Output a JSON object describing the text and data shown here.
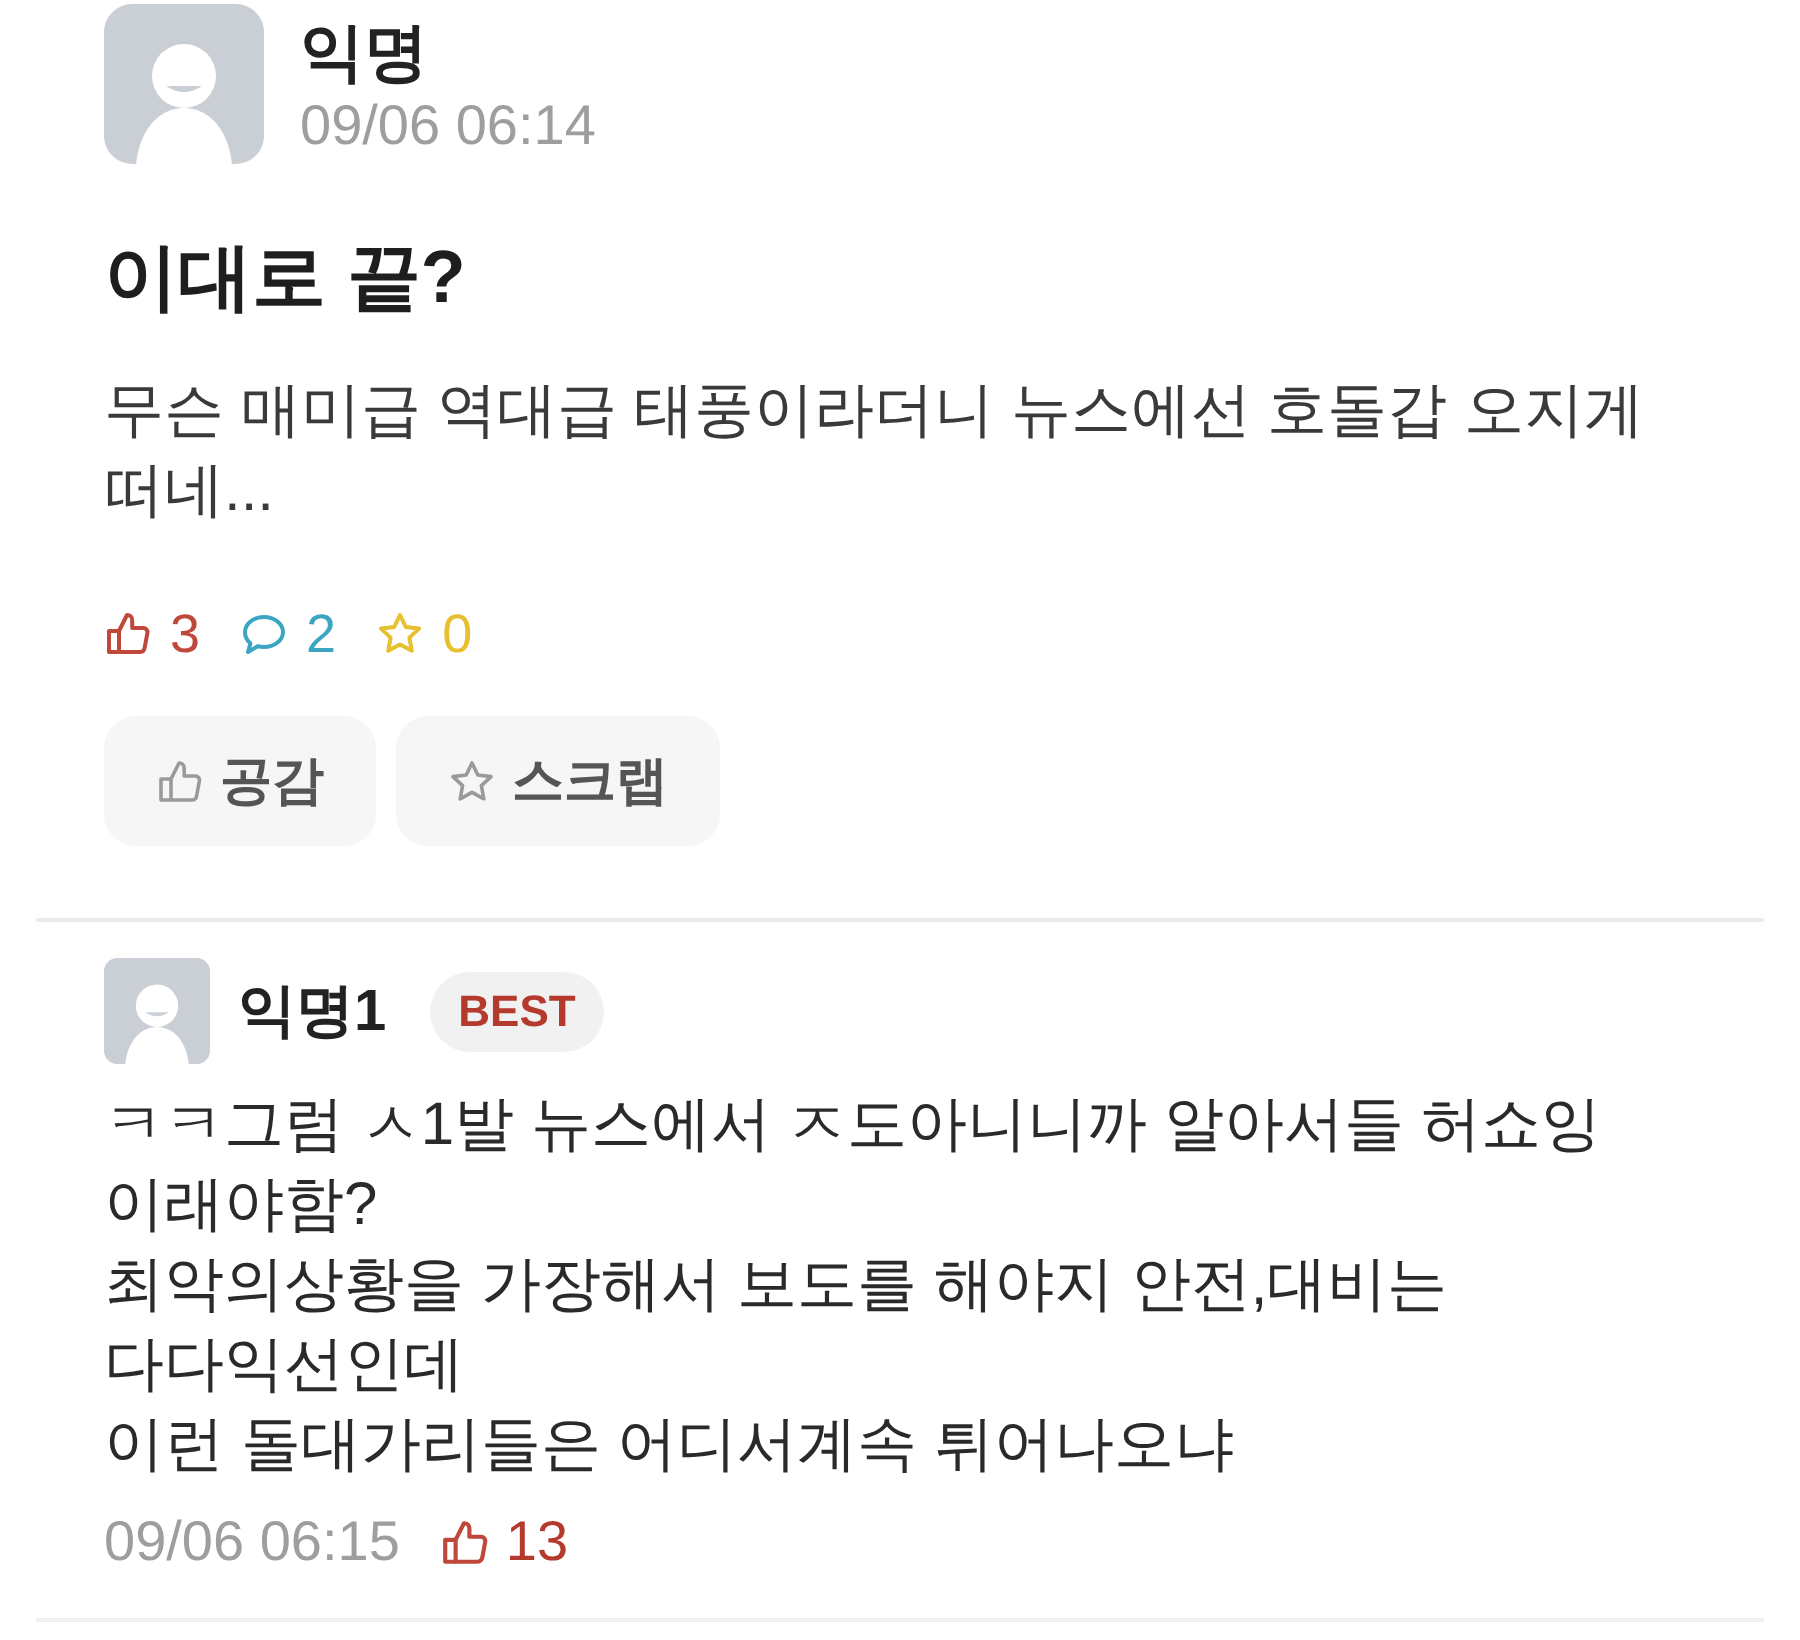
{
  "post": {
    "author": "익명",
    "time": "09/06 06:14",
    "title": "이대로 끝?",
    "body": "무슨 매미급 역대급 태풍이라더니 뉴스에선 호돌갑 오지게\n떠네...",
    "stats": [
      {
        "kind": "like",
        "count": "3",
        "color": "#c0483b"
      },
      {
        "kind": "comment",
        "count": "2",
        "color": "#3aa6c4"
      },
      {
        "kind": "scrap",
        "count": "0",
        "color": "#e6c02e"
      }
    ],
    "buttons": [
      {
        "kind": "like",
        "label": "공감"
      },
      {
        "kind": "scrap",
        "label": "스크랩"
      }
    ]
  },
  "comments": [
    {
      "author": "익명1",
      "badge": "BEST",
      "body": "ㅋㅋ그럼 ㅅ1발 뉴스에서 ㅈ도아니니까 알아서들 허쇼잉\n이래야함?\n최악의상황을 가장해서 보도를 해야지 안전,대비는\n다다익선인데\n이런 돌대가리들은 어디서계속 튀어나오냐",
      "time": "09/06 06:15",
      "likes": "13"
    }
  ]
}
